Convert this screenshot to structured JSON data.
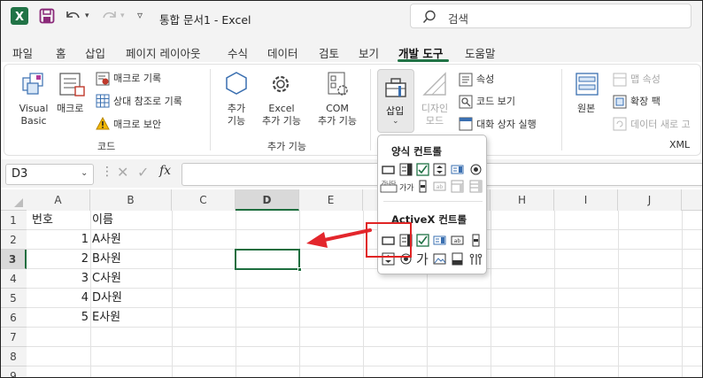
{
  "titlebar": {
    "autosave_icon": "save-icon",
    "undo_icon": "undo-icon",
    "redo_icon": "redo-icon",
    "qat_more": "▿",
    "doc_title": "통합 문서1  -  Excel",
    "search_placeholder": "검색"
  },
  "menu": [
    "파일",
    "홈",
    "삽입",
    "페이지 레이아웃",
    "수식",
    "데이터",
    "검토",
    "보기",
    "개발 도구",
    "도움말"
  ],
  "ribbon": {
    "code_group": {
      "visual_basic": [
        "Visual",
        "Basic"
      ],
      "macro": "매크로",
      "record_macro": "매크로 기록",
      "relative_ref": "상대 참조로 기록",
      "macro_security": "매크로 보안",
      "name": "코드"
    },
    "addins_group": {
      "addins": [
        "추가",
        "기능"
      ],
      "excel_addins": [
        "Excel",
        "추가 기능"
      ],
      "com_addins": [
        "COM",
        "추가 기능"
      ],
      "name": "추가 기능"
    },
    "controls_group": {
      "insert": "삽입",
      "design_mode": [
        "디자인",
        "모드"
      ],
      "properties": "속성",
      "view_code": "코드 보기",
      "run_dialog": "대화 상자 실행"
    },
    "xml_group": {
      "source": "원본",
      "map_properties": "맵 속성",
      "expansion_packs": "확장 팩",
      "refresh_data": "데이터 새로 고",
      "name": "XML"
    }
  },
  "formula_bar": {
    "name_box": "D3",
    "fx": "fx",
    "content": ""
  },
  "sheet": {
    "columns": [
      "A",
      "B",
      "C",
      "D",
      "E",
      "F",
      "G",
      "H",
      "I",
      "J"
    ],
    "rows": [
      "1",
      "2",
      "3",
      "4",
      "5",
      "6",
      "7",
      "8",
      "9"
    ],
    "header_row": [
      "번호",
      "이름"
    ],
    "data": [
      [
        "1",
        "A사원"
      ],
      [
        "2",
        "B사원"
      ],
      [
        "3",
        "C사원"
      ],
      [
        "4",
        "D사원"
      ],
      [
        "5",
        "E사원"
      ]
    ],
    "selected_cell": "D3"
  },
  "insert_dropdown": {
    "form_controls_title": "양식 컨트롤",
    "activex_controls_title": "ActiveX 컨트롤",
    "form_label_sample": "가가",
    "form_groupbox_sample": "가나다",
    "activex_label_sample": "가"
  },
  "colors": {
    "excel_green": "#217346",
    "highlight_red": "#e02424",
    "arrow_red": "#e3262c",
    "selection_border": "#1e6e3f"
  }
}
